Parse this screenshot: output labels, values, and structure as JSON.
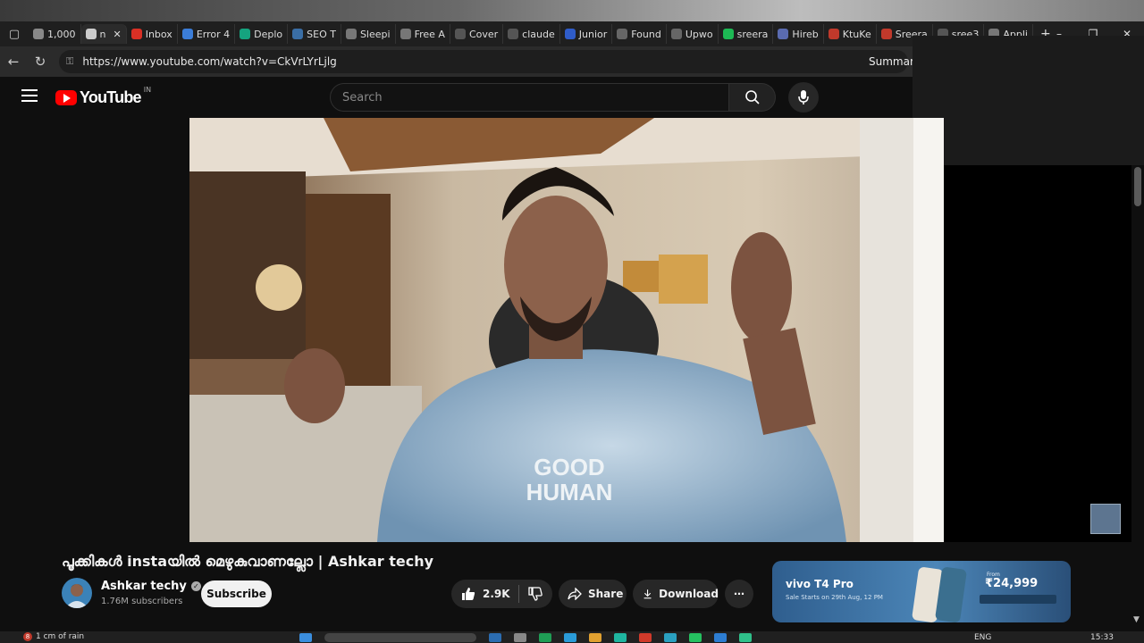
{
  "browser": {
    "tabs": [
      {
        "label": "1,000",
        "icon": "info-icon",
        "color": "#888888"
      },
      {
        "label": "n",
        "icon": "speaker-icon",
        "color": "#cccccc",
        "active": true
      },
      {
        "label": "Inbox",
        "icon": "gmail-icon",
        "color": "#d93025"
      },
      {
        "label": "Error 4",
        "icon": "chart-icon",
        "color": "#3b7dd8"
      },
      {
        "label": "Deplo",
        "icon": "diamond-icon",
        "color": "#15a37f"
      },
      {
        "label": "SEO T",
        "icon": "seo-icon",
        "color": "#3a6ea5"
      },
      {
        "label": "Sleepi",
        "icon": "p-icon",
        "color": "#777777"
      },
      {
        "label": "Free A",
        "icon": "p-icon",
        "color": "#777777"
      },
      {
        "label": "Cover",
        "icon": "openai-icon",
        "color": "#555555"
      },
      {
        "label": "claude",
        "icon": "github-icon",
        "color": "#555555"
      },
      {
        "label": "Junior",
        "icon": "blue-circle-icon",
        "color": "#2f5cc9"
      },
      {
        "label": "Found",
        "icon": "check-icon",
        "color": "#666666"
      },
      {
        "label": "Upwo",
        "icon": "upwork-icon",
        "color": "#666666"
      },
      {
        "label": "sreera",
        "icon": "k-icon",
        "color": "#1db954"
      },
      {
        "label": "Hireb",
        "icon": "hb-icon",
        "color": "#5a6bb0"
      },
      {
        "label": "KtuKe",
        "icon": "ktu-icon",
        "color": "#c0392b"
      },
      {
        "label": "Sreera",
        "icon": "doc-icon",
        "color": "#c0392b"
      },
      {
        "label": "sree3",
        "icon": "github-icon",
        "color": "#555555"
      },
      {
        "label": "Appli",
        "icon": "bird-icon",
        "color": "#777777"
      }
    ],
    "new_tab": "+",
    "window_controls": [
      "–",
      "❐",
      "✕"
    ],
    "url": "https://www.youtube.com/watch?v=CkVrLYrLjlg",
    "summarize_label": "Summariz"
  },
  "youtube": {
    "logo_text": "YouTube",
    "country_code": "IN",
    "search_placeholder": "Search"
  },
  "video": {
    "title": "പൂക്കികൾ instaയിൽ മെഴുകുവാണല്ലോ | Ashkar techy",
    "shirt_text_1": "GOOD",
    "shirt_text_2": "HUMAN"
  },
  "channel": {
    "name": "Ashkar techy",
    "subscribers": "1.76M subscribers",
    "subscribe_label": "Subscribe"
  },
  "actions": {
    "likes": "2.9K",
    "share_label": "Share",
    "download_label": "Download",
    "more_label": "⋯"
  },
  "ad": {
    "brand": "vivo T4 Pro",
    "tagline": "Sale Starts on 29th Aug, 12 PM",
    "price_prefix": "From",
    "price": "₹24,999"
  },
  "taskbar": {
    "notification_count": "8",
    "weather": "1 cm of rain",
    "language": "ENG",
    "time": "15:33"
  },
  "colors": {
    "yt_red": "#ff0000",
    "page_bg": "#0f0f0f",
    "pill_bg": "#272727"
  }
}
